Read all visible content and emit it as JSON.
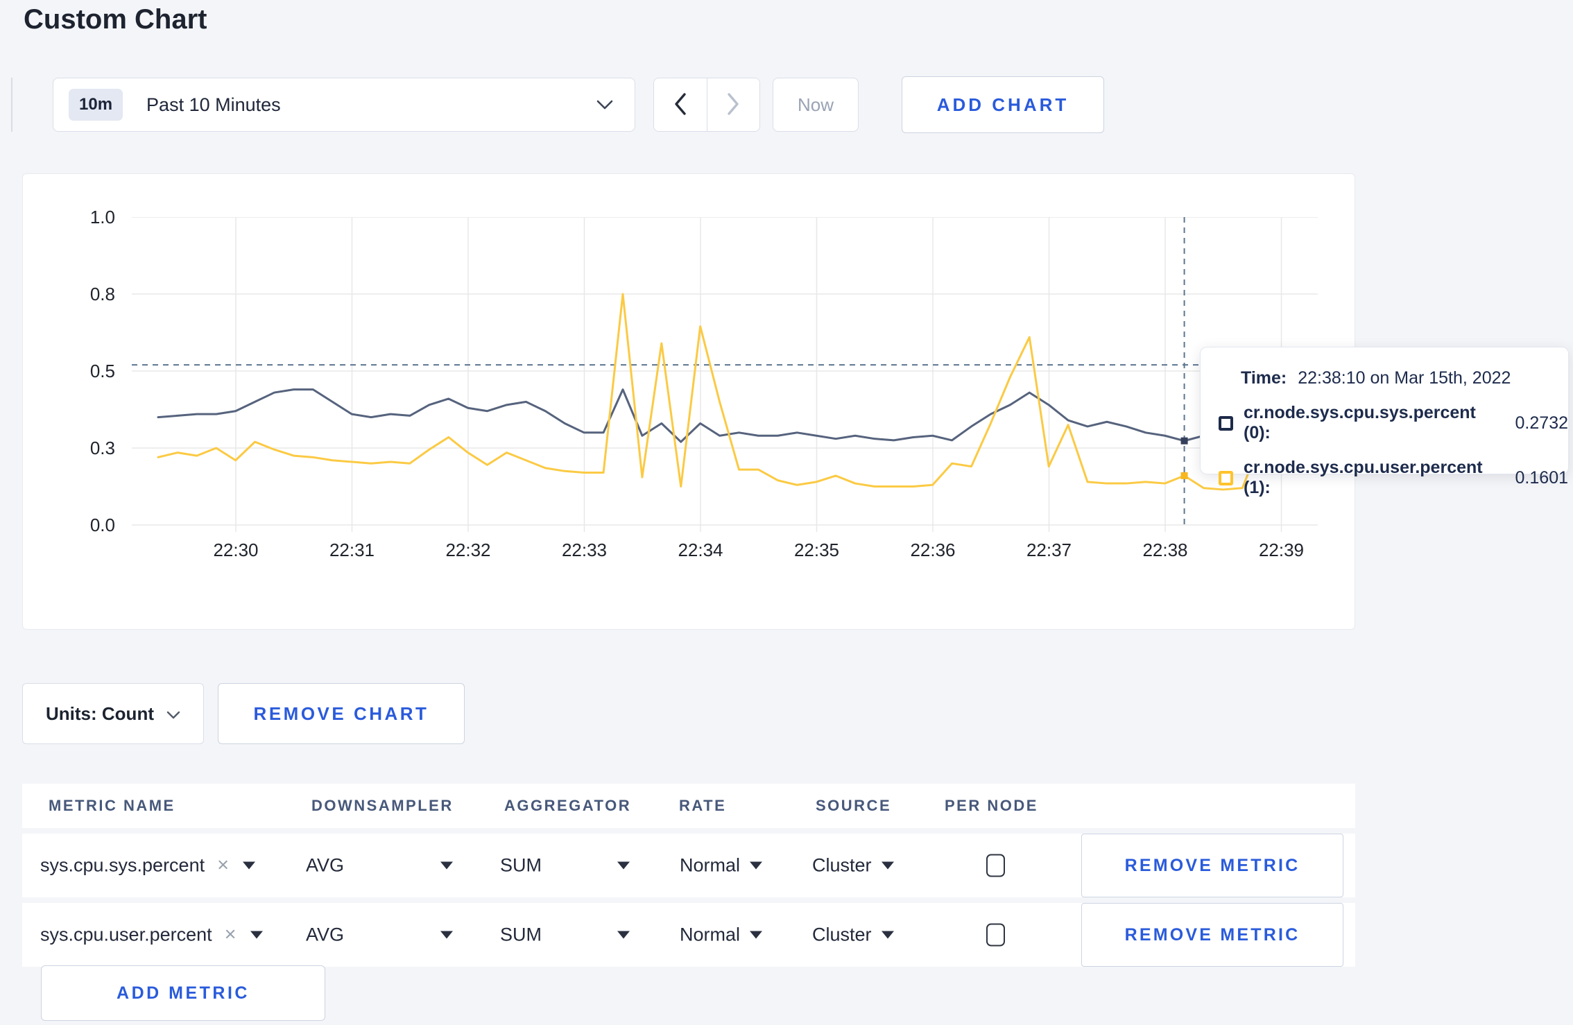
{
  "page": {
    "title": "Custom Chart"
  },
  "toolbar": {
    "range_badge": "10m",
    "range_label": "Past 10 Minutes",
    "now_label": "Now",
    "add_chart_label": "ADD CHART"
  },
  "chart_data": {
    "type": "line",
    "x_start": "22:29:20",
    "x_interval_seconds": 10,
    "x_ticks": [
      "22:30",
      "22:31",
      "22:32",
      "22:33",
      "22:34",
      "22:35",
      "22:36",
      "22:37",
      "22:38",
      "22:39"
    ],
    "y_ticks": [
      {
        "label": "0.0",
        "value": 0
      },
      {
        "label": "0.3",
        "value": 0.25
      },
      {
        "label": "0.5",
        "value": 0.5
      },
      {
        "label": "0.8",
        "value": 0.75
      },
      {
        "label": "1.0",
        "value": 1
      }
    ],
    "ylim": [
      0,
      1
    ],
    "grid": true,
    "grid_color": "#e8e8e8",
    "series": [
      {
        "name": "cr.node.sys.cpu.sys.percent",
        "color": "#56637d",
        "values": [
          0.35,
          0.355,
          0.36,
          0.36,
          0.37,
          0.4,
          0.43,
          0.44,
          0.44,
          0.4,
          0.36,
          0.35,
          0.36,
          0.355,
          0.39,
          0.41,
          0.38,
          0.37,
          0.39,
          0.4,
          0.37,
          0.33,
          0.3,
          0.3,
          0.44,
          0.29,
          0.33,
          0.27,
          0.33,
          0.29,
          0.3,
          0.29,
          0.29,
          0.3,
          0.29,
          0.28,
          0.29,
          0.28,
          0.275,
          0.285,
          0.29,
          0.275,
          0.32,
          0.36,
          0.39,
          0.43,
          0.39,
          0.34,
          0.32,
          0.335,
          0.32,
          0.3,
          0.29,
          0.2732,
          0.29,
          0.285,
          0.29,
          0.285,
          0.3,
          0.29
        ]
      },
      {
        "name": "cr.node.sys.cpu.user.percent",
        "color": "#fbca44",
        "values": [
          0.22,
          0.235,
          0.225,
          0.25,
          0.21,
          0.27,
          0.245,
          0.225,
          0.22,
          0.21,
          0.205,
          0.2,
          0.205,
          0.2,
          0.245,
          0.285,
          0.235,
          0.195,
          0.235,
          0.21,
          0.185,
          0.175,
          0.17,
          0.17,
          0.75,
          0.155,
          0.59,
          0.125,
          0.645,
          0.4,
          0.18,
          0.18,
          0.145,
          0.13,
          0.14,
          0.16,
          0.135,
          0.125,
          0.125,
          0.125,
          0.13,
          0.2,
          0.19,
          0.33,
          0.48,
          0.61,
          0.19,
          0.325,
          0.14,
          0.135,
          0.135,
          0.14,
          0.135,
          0.1601,
          0.12,
          0.115,
          0.12,
          0.28,
          0.26,
          0.215
        ]
      }
    ],
    "crosshair": {
      "index": 53,
      "time": "22:38:10",
      "guide_value": 0.52,
      "line_color": "#5c7590",
      "dot_colors": [
        "#34405b",
        "#f6b71f"
      ]
    }
  },
  "tooltip": {
    "time_label": "Time:",
    "time_value": "22:38:10 on Mar 15th, 2022",
    "rows": [
      {
        "label": "cr.node.sys.cpu.sys.percent (0):",
        "value": "0.2732",
        "swatch": "#1e2a49"
      },
      {
        "label": "cr.node.sys.cpu.user.percent (1):",
        "value": "0.1601",
        "swatch": "#ffc42c"
      }
    ]
  },
  "chart_controls": {
    "units_label": "Units: Count",
    "remove_chart_label": "REMOVE CHART"
  },
  "metrics_table": {
    "headers": [
      "METRIC NAME",
      "DOWNSAMPLER",
      "AGGREGATOR",
      "RATE",
      "SOURCE",
      "PER NODE"
    ],
    "rows": [
      {
        "metric": "sys.cpu.sys.percent",
        "clear": "×",
        "downsampler": "AVG",
        "aggregator": "SUM",
        "rate": "Normal",
        "source": "Cluster",
        "per_node_checked": false,
        "remove_label": "REMOVE METRIC"
      },
      {
        "metric": "sys.cpu.user.percent",
        "clear": "×",
        "downsampler": "AVG",
        "aggregator": "SUM",
        "rate": "Normal",
        "source": "Cluster",
        "per_node_checked": false,
        "remove_label": "REMOVE METRIC"
      }
    ],
    "add_metric_label": "ADD METRIC"
  }
}
